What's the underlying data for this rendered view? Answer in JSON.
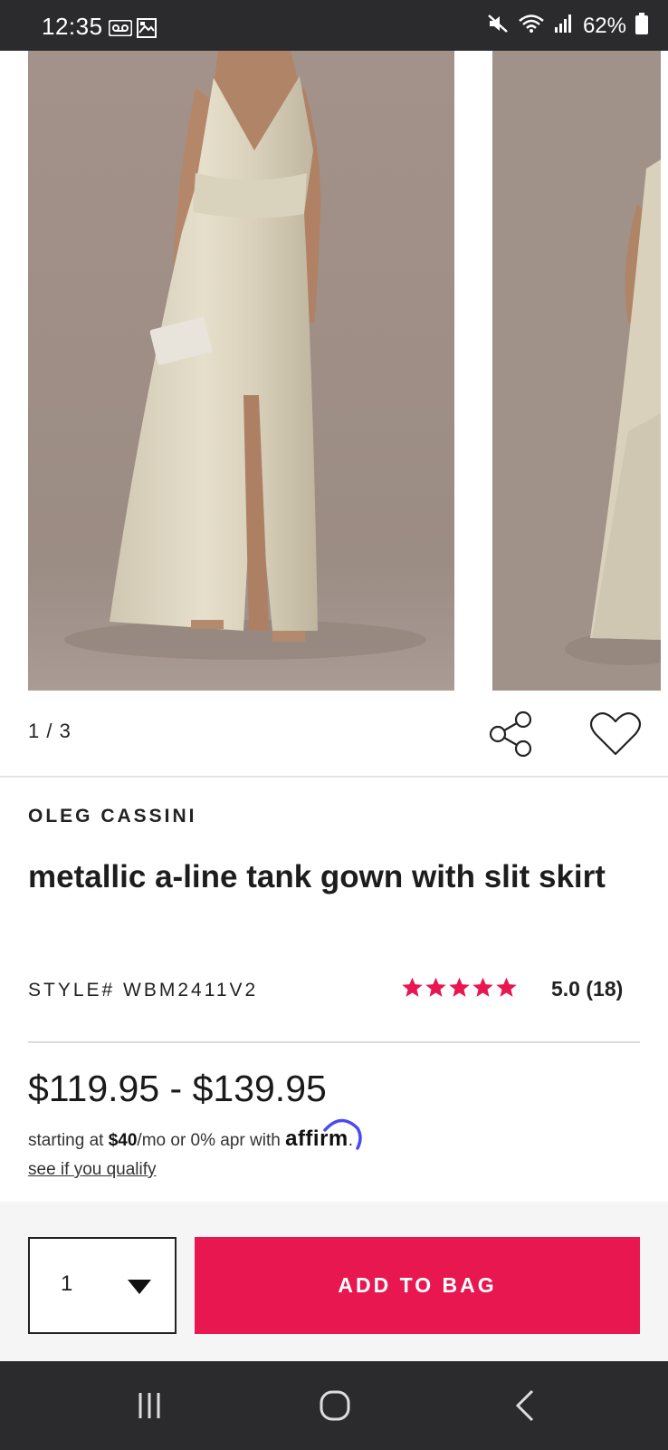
{
  "status_bar": {
    "time": "12:35",
    "battery": "62%",
    "icons": [
      "voicemail-icon",
      "photo-icon",
      "mute-icon",
      "wifi-icon",
      "signal-icon",
      "battery-icon"
    ]
  },
  "gallery": {
    "page_counter": "1 / 3",
    "images": [
      "gown-front-photo",
      "gown-side-photo"
    ]
  },
  "product": {
    "brand": "OLEG CASSINI",
    "title": "metallic a-line tank gown with slit skirt",
    "style_number": "STYLE# WBM2411V2",
    "rating": 5,
    "rating_text": "5.0 (18)",
    "price": "$119.95 - $139.95",
    "financing": {
      "prefix": "starting at ",
      "amount": "$40",
      "suffix": "/mo or 0% apr with ",
      "provider": "affirm",
      "end": "."
    },
    "qualify_link": "see if you qualify"
  },
  "actions": {
    "quantity": "1",
    "add_to_bag": "ADD TO BAG"
  },
  "colors": {
    "accent": "#e8174f",
    "star": "#e8174f",
    "status_bar": "#2b2b2e",
    "affirm_arc": "#4a4af4"
  },
  "nav": {
    "icons": [
      "recent-apps-icon",
      "home-icon",
      "back-icon"
    ]
  }
}
